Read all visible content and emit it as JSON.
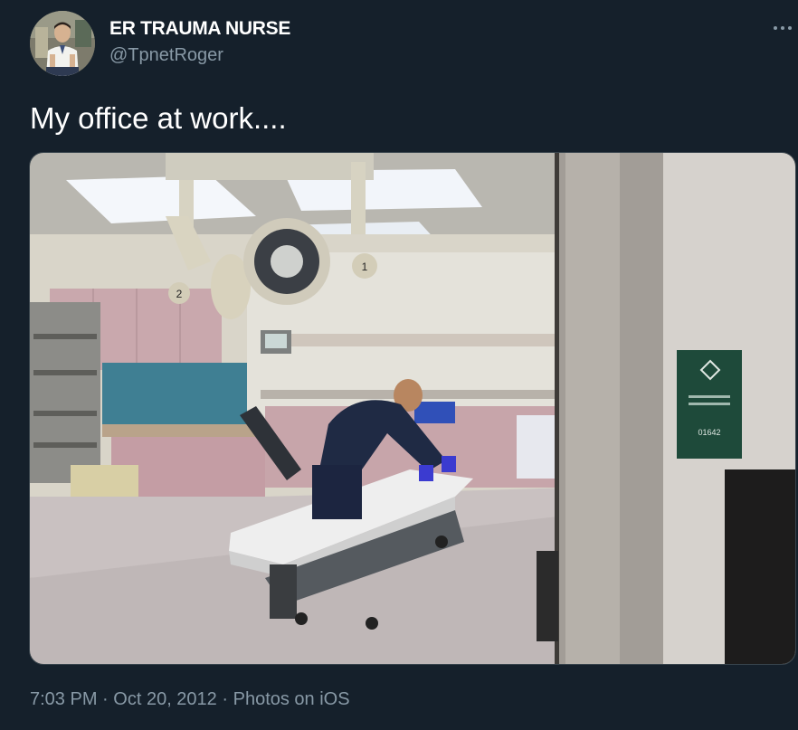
{
  "tweet": {
    "display_name": "ER TRAUMA NURSE",
    "handle": "@TpnetRoger",
    "text": "My office at work....",
    "time": "7:03 PM",
    "separator": "·",
    "date": "Oct 20, 2012",
    "source": "Photos on iOS"
  },
  "photo": {
    "sign_text": "01642"
  },
  "colors": {
    "background": "#15202b",
    "text_primary": "#ffffff",
    "text_secondary": "#8899a6",
    "border": "#38444d"
  },
  "icons": {
    "more": "more-horizontal-icon"
  }
}
